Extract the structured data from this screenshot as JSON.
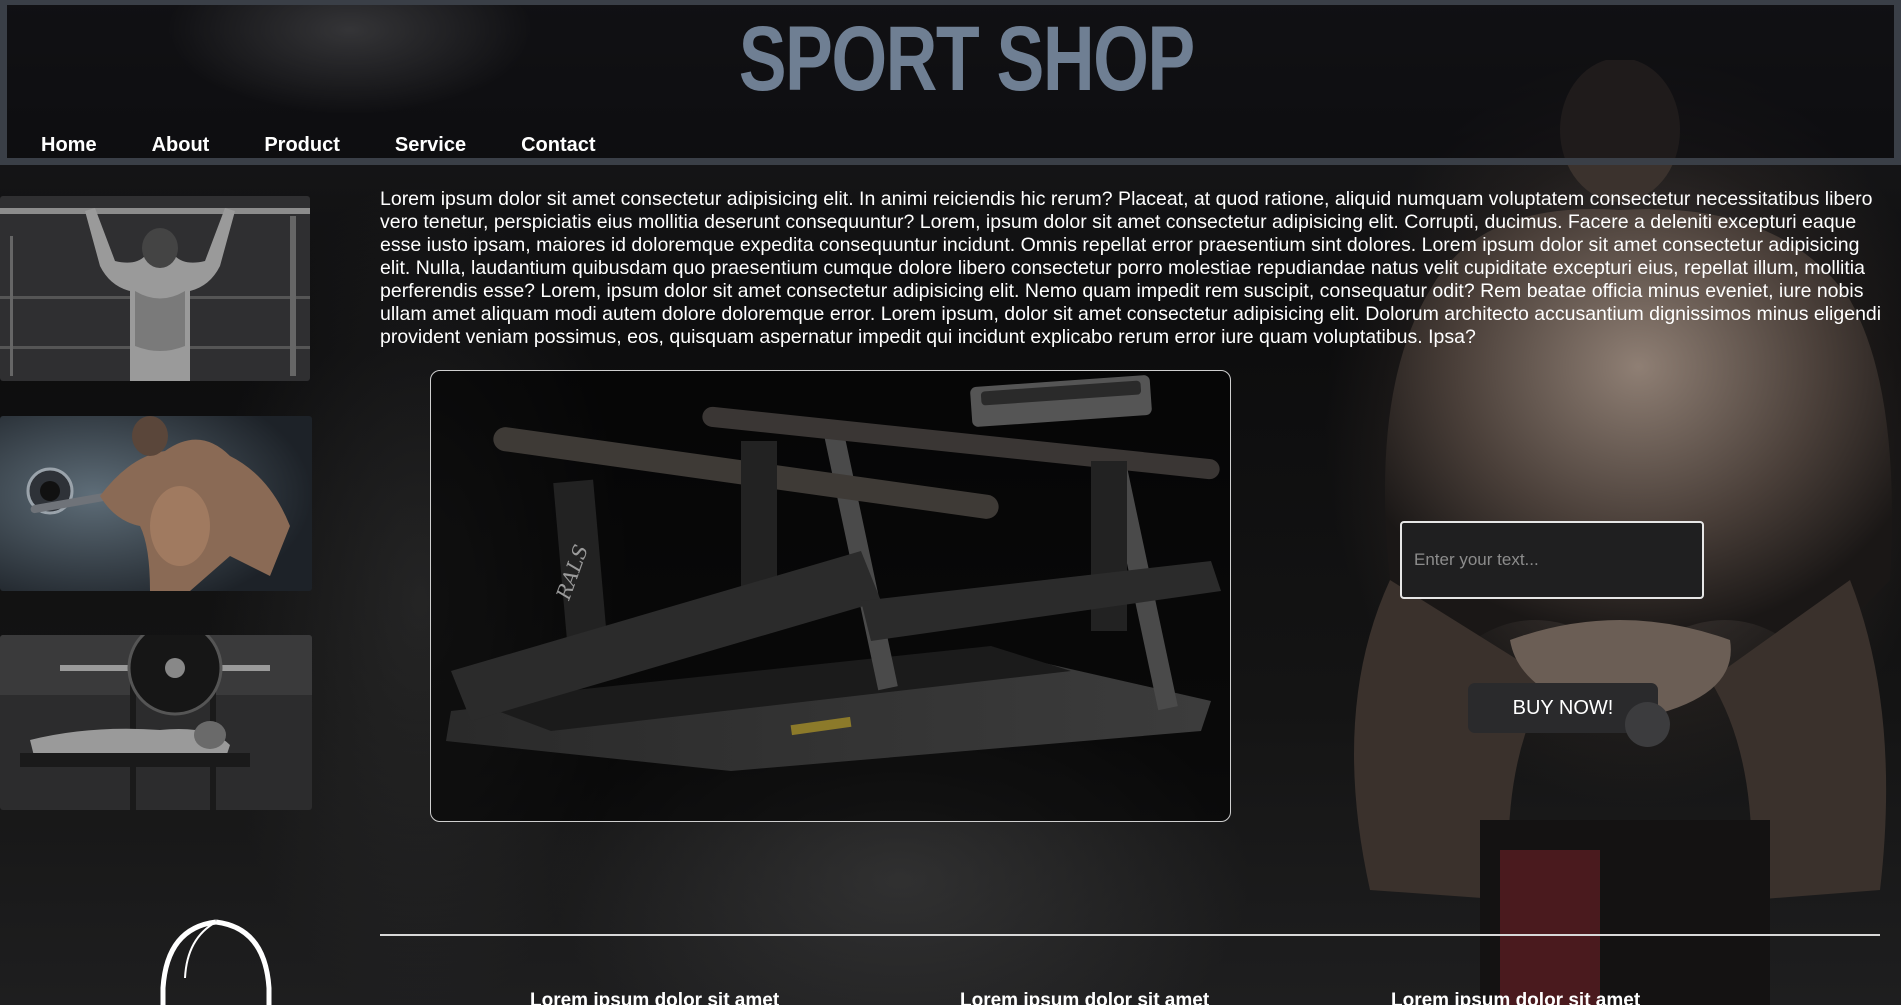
{
  "site": {
    "title": "SPORT SHOP"
  },
  "nav": {
    "items": [
      {
        "label": "Home"
      },
      {
        "label": "About"
      },
      {
        "label": "Product"
      },
      {
        "label": "Service"
      },
      {
        "label": "Contact"
      }
    ]
  },
  "intro": {
    "text": "Lorem ipsum dolor sit amet consectetur adipisicing elit. In animi reiciendis hic rerum? Placeat, at quod ratione, aliquid numquam voluptatem consectetur necessitatibus libero vero tenetur, perspiciatis eius mollitia deserunt consequuntur? Lorem, ipsum dolor sit amet consectetur adipisicing elit. Corrupti, ducimus. Facere a deleniti excepturi eaque esse iusto ipsam, maiores id doloremque expedita consequuntur incidunt. Omnis repellat error praesentium sint dolores. Lorem ipsum dolor sit amet consectetur adipisicing elit. Nulla, laudantium quibusdam quo praesentium cumque dolore libero consectetur porro molestiae repudiandae natus velit cupiditate excepturi eius, repellat illum, mollitia perferendis esse? Lorem, ipsum dolor sit amet consectetur adipisicing elit. Nemo quam impedit rem suscipit, consequatur odit? Rem beatae officia minus eveniet, iure nobis ullam amet aliquam modi autem dolore doloremque error. Lorem ipsum, dolor sit amet consectetur adipisicing elit. Dolorum architecto accusantium dignissimos minus eligendi provident veniam possimus, eos, quisquam aspernatur impedit qui incidunt explicabo rerum error iure quam voluptatibus. Ipsa?"
  },
  "showcase": {
    "product_brand": "RALS"
  },
  "form": {
    "input_placeholder": "Enter your text...",
    "buy_label": "BUY NOW!"
  },
  "footer": {
    "headings": [
      {
        "label": "Lorem ipsum dolor sit amet"
      },
      {
        "label": "Lorem ipsum dolor sit amet"
      },
      {
        "label": "Lorem ipsum dolor sit amet"
      }
    ]
  },
  "colors": {
    "header_border": "#3a3f47",
    "logo_text": "#6f7f93",
    "button_bg": "#2a2a2c",
    "input_bg": "#1f1f20"
  },
  "icons": {
    "ring_logo": "ring-logo-icon"
  }
}
